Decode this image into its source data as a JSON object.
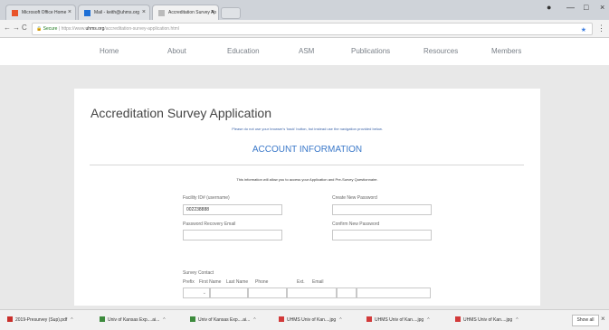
{
  "tabs": [
    {
      "label": "Microsoft Office Home",
      "icon": "office-icon",
      "color": "#e8532a"
    },
    {
      "label": "Mail - keith@uhms.org",
      "icon": "outlook-icon",
      "color": "#1d6fd6"
    },
    {
      "label": "Accreditation Survey Ap",
      "icon": "page-icon",
      "color": "#bbbbbb"
    }
  ],
  "address": {
    "secure_label": "Secure",
    "url_prefix": "https://www.",
    "domain": "uhms.org",
    "path": "/accreditation-survey-application.html"
  },
  "site_nav": [
    "Home",
    "About",
    "Education",
    "ASM",
    "Publications",
    "Resources",
    "Members"
  ],
  "form": {
    "title": "Accreditation Survey Application",
    "notice": "Please do not use your browser's 'back' button, but instead use the navigation provided below.",
    "section": "ACCOUNT INFORMATION",
    "intro": "This information will allow you to access your Application and Pre-Survey Questionnaire.",
    "facility_label": "Facility ID# (username)",
    "facility_value": "002238888",
    "new_password_label": "Create New Password",
    "recovery_email_label": "Password Recovery Email",
    "confirm_password_label": "Confirm New Password",
    "survey_contact_label": "Survey Contact",
    "contact_cols": [
      "Prefix",
      "First Name",
      "Last Name",
      "Phone",
      "Ext.",
      "Email"
    ]
  },
  "downloads": [
    {
      "label": "2019-Presurvey (Sup).pdf",
      "color": "#c9302c"
    },
    {
      "label": "Univ of Kansas Exp....ai...",
      "color": "#3d8b3d"
    },
    {
      "label": "Univ of Kansas Exp....ai...",
      "color": "#3d8b3d"
    },
    {
      "label": "UHMS Univ of Kan....jpg",
      "color": "#d23a3a"
    },
    {
      "label": "UHMS Univ of Kan....jpg",
      "color": "#d23a3a"
    },
    {
      "label": "UHMS Univ of Kan....jpg",
      "color": "#d23a3a"
    }
  ],
  "show_all": "Show all"
}
